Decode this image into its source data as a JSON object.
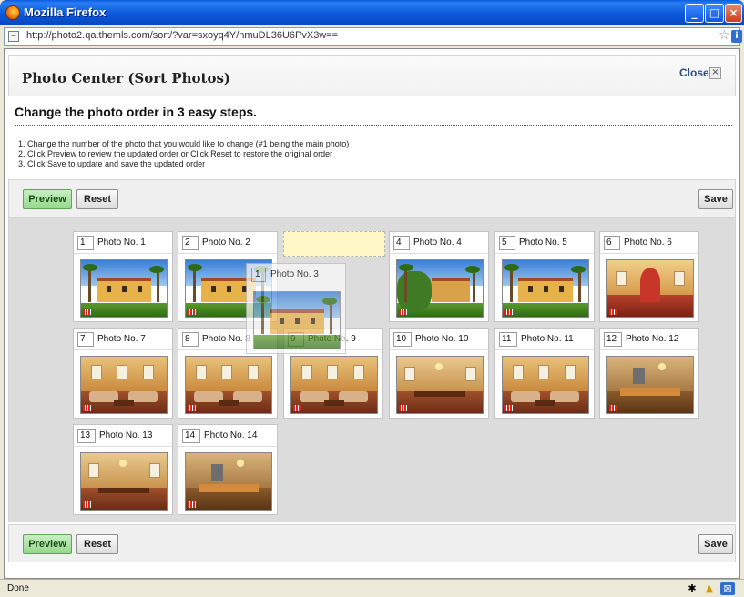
{
  "window": {
    "title": "Mozilla Firefox",
    "url": "http://photo2.qa.themls.com/sort/?var=sxoyq4Y/nmuDL36U6PvX3w=="
  },
  "header": {
    "title": "Photo Center (Sort Photos)",
    "close_label": "Close",
    "close_icon": "×"
  },
  "subtitle": "Change the photo order in 3 easy steps.",
  "steps": [
    "1.  Change the number of the photo that you would like to change (#1 being the main photo)",
    "2.  Click Preview to review the updated order or Click Reset to restore the original order",
    "3.  Click Save to update and save the updated order"
  ],
  "toolbar": {
    "preview_label": "Preview",
    "reset_label": "Reset",
    "save_label": "Save"
  },
  "tiles": [
    {
      "number": "1",
      "label": "Photo No. 1",
      "scene": "exterior"
    },
    {
      "number": "2",
      "label": "Photo No. 2",
      "scene": "exterior"
    },
    {
      "number": "4",
      "label": "Photo No. 4",
      "scene": "garden"
    },
    {
      "number": "5",
      "label": "Photo No. 5",
      "scene": "exterior"
    },
    {
      "number": "6",
      "label": "Photo No. 6",
      "scene": "hallway"
    },
    {
      "number": "7",
      "label": "Photo No. 7",
      "scene": "room"
    },
    {
      "number": "8",
      "label": "Photo No. 8",
      "scene": "room"
    },
    {
      "number": "9",
      "label": "Photo No. 9",
      "scene": "room"
    },
    {
      "number": "10",
      "label": "Photo No. 10",
      "scene": "dining"
    },
    {
      "number": "11",
      "label": "Photo No. 11",
      "scene": "room"
    },
    {
      "number": "12",
      "label": "Photo No. 12",
      "scene": "kitchen"
    },
    {
      "number": "13",
      "label": "Photo No. 13",
      "scene": "dining"
    },
    {
      "number": "14",
      "label": "Photo No. 14",
      "scene": "kitchen"
    }
  ],
  "dragging": {
    "number": "1",
    "label": "Photo No. 3",
    "scene": "exterior"
  },
  "status": {
    "text": "Done"
  },
  "icons": {
    "firefox": "firefox-logo-icon",
    "page": "page-icon",
    "bookmark_star": "star-icon",
    "site_info": "info-icon",
    "header_close": "close-icon",
    "status_spider": "spider-icon",
    "status_warning": "warning-icon",
    "status_addon": "addon-icon"
  },
  "colors": {
    "preview_button": "#95d88d",
    "drop_placeholder": "#fff8c6",
    "title_bar": "#0b58d9"
  }
}
